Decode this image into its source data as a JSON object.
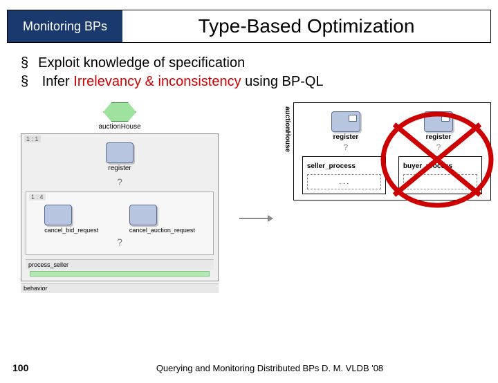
{
  "header": {
    "badge": "Monitoring  BPs",
    "title": "Type-Based Optimization"
  },
  "bullets": {
    "a_pre": "Exploit knowledge of specification",
    "b_pre": "Infer ",
    "b_red": "Irrelevancy & inconsistency",
    "b_post": " using BP-QL"
  },
  "left": {
    "top_label": "auctionHouse",
    "zoom_tag1": "1 : 1",
    "reg_label": "register",
    "question": "?",
    "zoom_tag2": "1 : 4",
    "cancel_bid": "cancel_bid_request",
    "cancel_auction": "cancel_auction_request",
    "process_seller": "process_seller",
    "behavior": "behavior"
  },
  "right": {
    "side_label": "auctionHouse",
    "reg_a": "register",
    "reg_b": "register",
    "q": "?",
    "seller": "seller_process",
    "buyer": "buyer_process",
    "dots": ". . ."
  },
  "footer": {
    "page": "100",
    "text": "Querying and Monitoring Distributed BPs D. M. VLDB '08"
  }
}
